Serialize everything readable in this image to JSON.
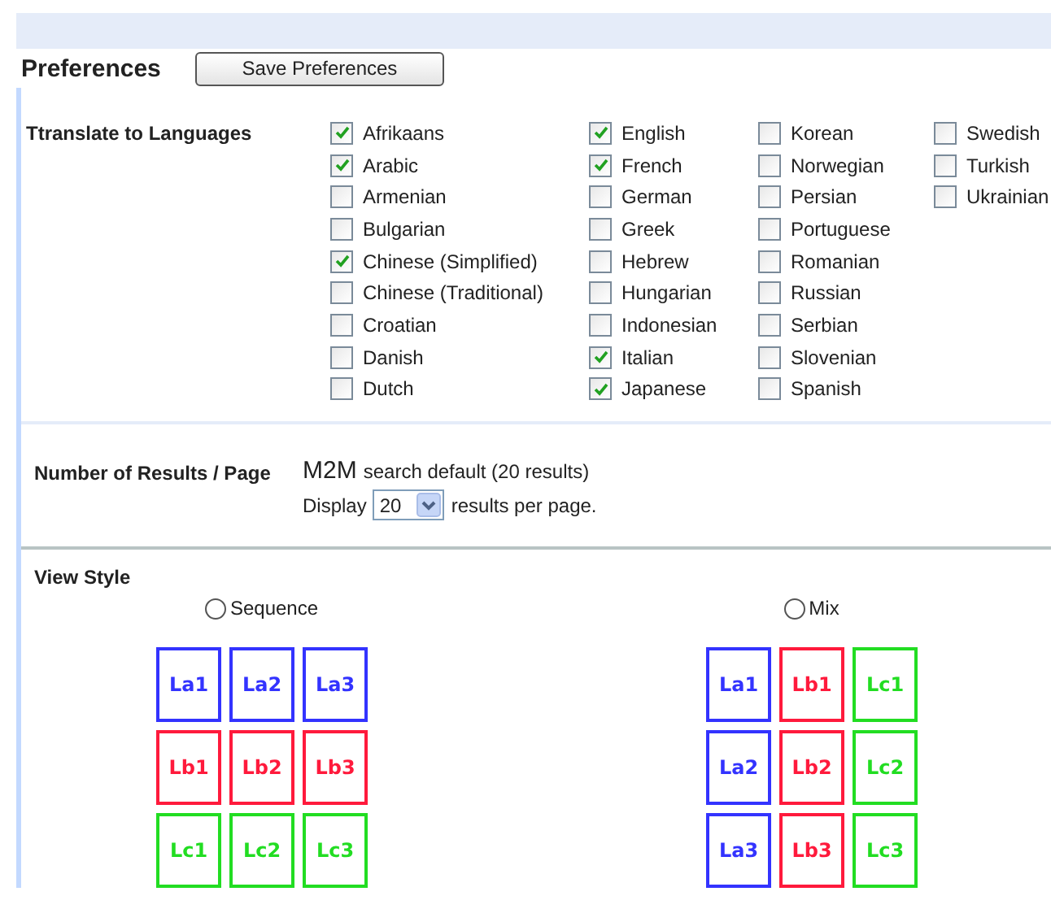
{
  "header": {
    "title": "Preferences",
    "save_button": "Save Preferences"
  },
  "languages": {
    "label": "Ttranslate to Languages",
    "items": [
      {
        "label": "Afrikaans",
        "checked": true
      },
      {
        "label": "Arabic",
        "checked": true
      },
      {
        "label": "Armenian",
        "checked": false
      },
      {
        "label": "Bulgarian",
        "checked": false
      },
      {
        "label": "Chinese (Simplified)",
        "checked": true
      },
      {
        "label": "Chinese (Traditional)",
        "checked": false
      },
      {
        "label": "Croatian",
        "checked": false
      },
      {
        "label": "Danish",
        "checked": false
      },
      {
        "label": "Dutch",
        "checked": false
      },
      {
        "label": "English",
        "checked": true
      },
      {
        "label": "French",
        "checked": true
      },
      {
        "label": "German",
        "checked": false
      },
      {
        "label": "Greek",
        "checked": false
      },
      {
        "label": "Hebrew",
        "checked": false
      },
      {
        "label": "Hungarian",
        "checked": false
      },
      {
        "label": "Indonesian",
        "checked": false
      },
      {
        "label": "Italian",
        "checked": true
      },
      {
        "label": "Japanese",
        "checked": true
      },
      {
        "label": "Korean",
        "checked": false
      },
      {
        "label": "Norwegian",
        "checked": false
      },
      {
        "label": "Persian",
        "checked": false
      },
      {
        "label": "Portuguese",
        "checked": false
      },
      {
        "label": "Romanian",
        "checked": false
      },
      {
        "label": "Russian",
        "checked": false
      },
      {
        "label": "Serbian",
        "checked": false
      },
      {
        "label": "Slovenian",
        "checked": false
      },
      {
        "label": "Spanish",
        "checked": false
      },
      {
        "label": "Swedish",
        "checked": false
      },
      {
        "label": "Turkish",
        "checked": false
      },
      {
        "label": "Ukrainian",
        "checked": false
      }
    ]
  },
  "results": {
    "label": "Number of Results / Page",
    "brand": "M2M",
    "default_text": "search default (20 results)",
    "display_label": "Display",
    "value": "20",
    "suffix": "results per page."
  },
  "view_style": {
    "label": "View Style",
    "options": [
      {
        "label": "Sequence",
        "selected": false,
        "tiles": [
          {
            "label": "La1",
            "color": "#3333ff"
          },
          {
            "label": "La2",
            "color": "#3333ff"
          },
          {
            "label": "La3",
            "color": "#3333ff"
          },
          {
            "label": "Lb1",
            "color": "#ff1a3c"
          },
          {
            "label": "Lb2",
            "color": "#ff1a3c"
          },
          {
            "label": "Lb3",
            "color": "#ff1a3c"
          },
          {
            "label": "Lc1",
            "color": "#22dd22"
          },
          {
            "label": "Lc2",
            "color": "#22dd22"
          },
          {
            "label": "Lc3",
            "color": "#22dd22"
          }
        ]
      },
      {
        "label": "Mix",
        "selected": false,
        "tiles": [
          {
            "label": "La1",
            "color": "#3333ff"
          },
          {
            "label": "Lb1",
            "color": "#ff1a3c"
          },
          {
            "label": "Lc1",
            "color": "#22dd22"
          },
          {
            "label": "La2",
            "color": "#3333ff"
          },
          {
            "label": "Lb2",
            "color": "#ff1a3c"
          },
          {
            "label": "Lc2",
            "color": "#22dd22"
          },
          {
            "label": "La3",
            "color": "#3333ff"
          },
          {
            "label": "Lb3",
            "color": "#ff1a3c"
          },
          {
            "label": "Lc3",
            "color": "#22dd22"
          }
        ]
      }
    ]
  }
}
